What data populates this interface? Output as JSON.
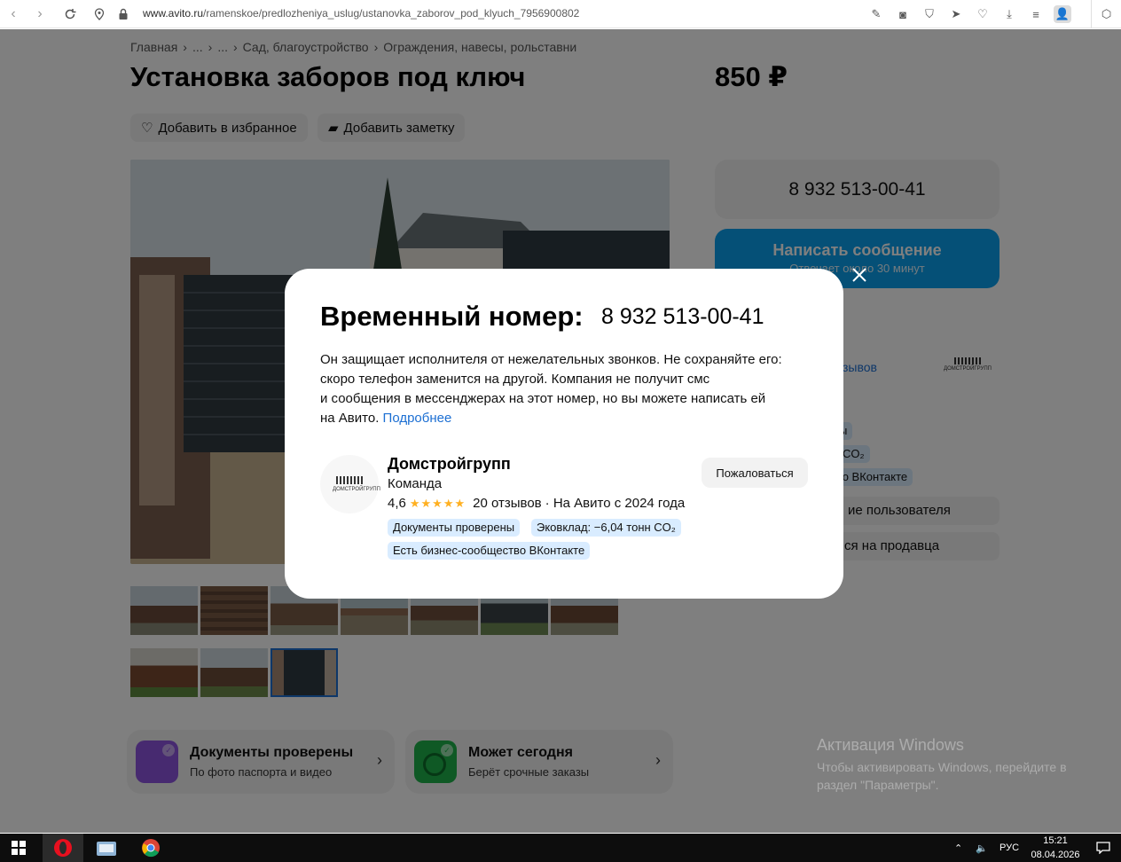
{
  "browser": {
    "url_domain": "www.avito.ru",
    "url_path": "/ramenskoe/predlozheniya_uslug/ustanovka_zaborov_pod_klyuch_7956900802"
  },
  "page": {
    "breadcrumbs": [
      "Главная",
      "›",
      "...",
      "›",
      "...",
      "›",
      "Сад, благоустройство",
      "›",
      "Ограждения, навесы, рольставни"
    ],
    "title": "Установка заборов под ключ",
    "price": "850 ₽",
    "add_favorite": "Добавить в избранное",
    "add_note": "Добавить заметку",
    "phone": "8 932 513-00-41",
    "message_button": "Написать сообщение",
    "message_sub": "Отвечает около 30 минут",
    "side_reviews_fragment": "зывов",
    "side_badge1_fragment": "ы",
    "side_badge2_fragment": "CO₂",
    "side_badge3_fragment": "тво ВКонтакте",
    "side_row1_fragment": "ие пользователя",
    "side_row2_fragment": "ся на продавца",
    "promo1_title": "Документы проверены",
    "promo1_sub": "По фото паспорта и видео",
    "promo2_title": "Может сегодня",
    "promo2_sub": "Берёт срочные заказы"
  },
  "modal": {
    "title": "Временный номер:",
    "phone": "8 932 513-00-41",
    "text_line1": "Он защищает исполнителя от нежелательных звонков. Не сохраняйте его:",
    "text_line2": "скоро телефон заменится на другой. Компания не получит смс",
    "text_line3": "и сообщения в мессенджерах на этот номер, но вы можете написать ей",
    "text_line4": "на Авито.",
    "more_link": "Подробнее",
    "seller_name": "Домстройгрупп",
    "seller_type": "Команда",
    "rating": "4,6",
    "reviews": "20 отзывов",
    "since": "· На Авито с 2024 года",
    "badge1": "Документы проверены",
    "badge2": "Эковклад: −6,04 тонн CO₂",
    "badge3": "Есть бизнес-сообщество ВКонтакте",
    "complain": "Пожаловаться",
    "logo_text": "ДОМСТРОЙГРУПП",
    "rating_stars": 4.6
  },
  "watermark": {
    "title": "Активация Windows",
    "line1": "Чтобы активировать Windows, перейдите в",
    "line2": "раздел \"Параметры\"."
  },
  "taskbar": {
    "lang": "РУС",
    "time": "15:21",
    "date": "08.04.2026"
  }
}
